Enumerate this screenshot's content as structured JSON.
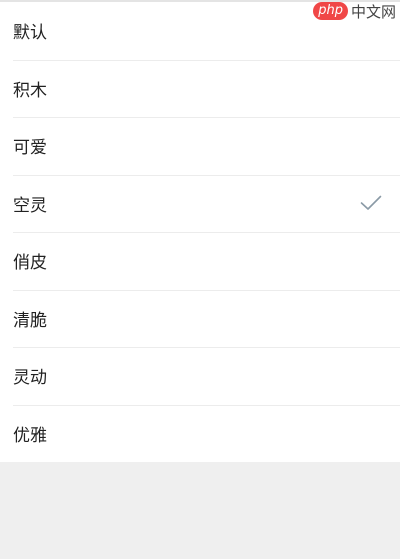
{
  "watermark": {
    "badge": "php",
    "text": "中文网"
  },
  "options": [
    {
      "label": "默认",
      "selected": false
    },
    {
      "label": "积木",
      "selected": false
    },
    {
      "label": "可爱",
      "selected": false
    },
    {
      "label": "空灵",
      "selected": true
    },
    {
      "label": "俏皮",
      "selected": false
    },
    {
      "label": "清脆",
      "selected": false
    },
    {
      "label": "灵动",
      "selected": false
    },
    {
      "label": "优雅",
      "selected": false
    }
  ],
  "colors": {
    "check": "#8a9aa6",
    "watermark_badge": "#f04747"
  },
  "icons": {
    "selected_marker": "checkmark-icon"
  }
}
